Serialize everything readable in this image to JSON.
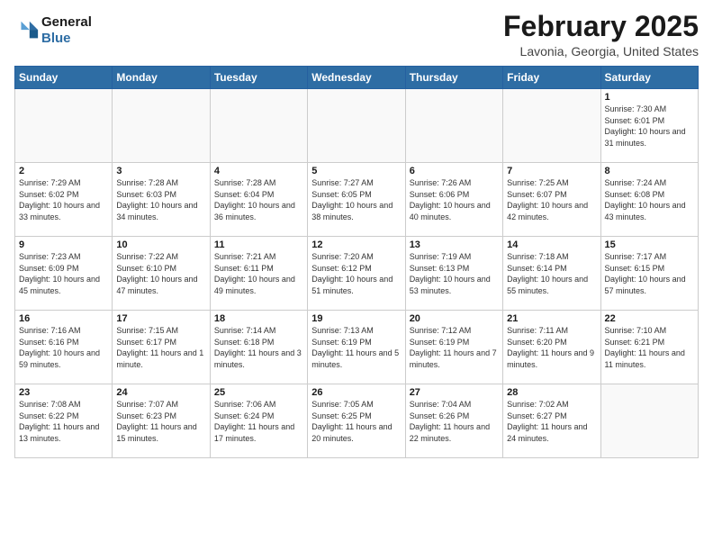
{
  "header": {
    "logo": {
      "line1": "General",
      "line2": "Blue"
    },
    "title": "February 2025",
    "location": "Lavonia, Georgia, United States"
  },
  "weekdays": [
    "Sunday",
    "Monday",
    "Tuesday",
    "Wednesday",
    "Thursday",
    "Friday",
    "Saturday"
  ],
  "weeks": [
    [
      {
        "day": "",
        "info": ""
      },
      {
        "day": "",
        "info": ""
      },
      {
        "day": "",
        "info": ""
      },
      {
        "day": "",
        "info": ""
      },
      {
        "day": "",
        "info": ""
      },
      {
        "day": "",
        "info": ""
      },
      {
        "day": "1",
        "info": "Sunrise: 7:30 AM\nSunset: 6:01 PM\nDaylight: 10 hours and 31 minutes."
      }
    ],
    [
      {
        "day": "2",
        "info": "Sunrise: 7:29 AM\nSunset: 6:02 PM\nDaylight: 10 hours and 33 minutes."
      },
      {
        "day": "3",
        "info": "Sunrise: 7:28 AM\nSunset: 6:03 PM\nDaylight: 10 hours and 34 minutes."
      },
      {
        "day": "4",
        "info": "Sunrise: 7:28 AM\nSunset: 6:04 PM\nDaylight: 10 hours and 36 minutes."
      },
      {
        "day": "5",
        "info": "Sunrise: 7:27 AM\nSunset: 6:05 PM\nDaylight: 10 hours and 38 minutes."
      },
      {
        "day": "6",
        "info": "Sunrise: 7:26 AM\nSunset: 6:06 PM\nDaylight: 10 hours and 40 minutes."
      },
      {
        "day": "7",
        "info": "Sunrise: 7:25 AM\nSunset: 6:07 PM\nDaylight: 10 hours and 42 minutes."
      },
      {
        "day": "8",
        "info": "Sunrise: 7:24 AM\nSunset: 6:08 PM\nDaylight: 10 hours and 43 minutes."
      }
    ],
    [
      {
        "day": "9",
        "info": "Sunrise: 7:23 AM\nSunset: 6:09 PM\nDaylight: 10 hours and 45 minutes."
      },
      {
        "day": "10",
        "info": "Sunrise: 7:22 AM\nSunset: 6:10 PM\nDaylight: 10 hours and 47 minutes."
      },
      {
        "day": "11",
        "info": "Sunrise: 7:21 AM\nSunset: 6:11 PM\nDaylight: 10 hours and 49 minutes."
      },
      {
        "day": "12",
        "info": "Sunrise: 7:20 AM\nSunset: 6:12 PM\nDaylight: 10 hours and 51 minutes."
      },
      {
        "day": "13",
        "info": "Sunrise: 7:19 AM\nSunset: 6:13 PM\nDaylight: 10 hours and 53 minutes."
      },
      {
        "day": "14",
        "info": "Sunrise: 7:18 AM\nSunset: 6:14 PM\nDaylight: 10 hours and 55 minutes."
      },
      {
        "day": "15",
        "info": "Sunrise: 7:17 AM\nSunset: 6:15 PM\nDaylight: 10 hours and 57 minutes."
      }
    ],
    [
      {
        "day": "16",
        "info": "Sunrise: 7:16 AM\nSunset: 6:16 PM\nDaylight: 10 hours and 59 minutes."
      },
      {
        "day": "17",
        "info": "Sunrise: 7:15 AM\nSunset: 6:17 PM\nDaylight: 11 hours and 1 minute."
      },
      {
        "day": "18",
        "info": "Sunrise: 7:14 AM\nSunset: 6:18 PM\nDaylight: 11 hours and 3 minutes."
      },
      {
        "day": "19",
        "info": "Sunrise: 7:13 AM\nSunset: 6:19 PM\nDaylight: 11 hours and 5 minutes."
      },
      {
        "day": "20",
        "info": "Sunrise: 7:12 AM\nSunset: 6:19 PM\nDaylight: 11 hours and 7 minutes."
      },
      {
        "day": "21",
        "info": "Sunrise: 7:11 AM\nSunset: 6:20 PM\nDaylight: 11 hours and 9 minutes."
      },
      {
        "day": "22",
        "info": "Sunrise: 7:10 AM\nSunset: 6:21 PM\nDaylight: 11 hours and 11 minutes."
      }
    ],
    [
      {
        "day": "23",
        "info": "Sunrise: 7:08 AM\nSunset: 6:22 PM\nDaylight: 11 hours and 13 minutes."
      },
      {
        "day": "24",
        "info": "Sunrise: 7:07 AM\nSunset: 6:23 PM\nDaylight: 11 hours and 15 minutes."
      },
      {
        "day": "25",
        "info": "Sunrise: 7:06 AM\nSunset: 6:24 PM\nDaylight: 11 hours and 17 minutes."
      },
      {
        "day": "26",
        "info": "Sunrise: 7:05 AM\nSunset: 6:25 PM\nDaylight: 11 hours and 20 minutes."
      },
      {
        "day": "27",
        "info": "Sunrise: 7:04 AM\nSunset: 6:26 PM\nDaylight: 11 hours and 22 minutes."
      },
      {
        "day": "28",
        "info": "Sunrise: 7:02 AM\nSunset: 6:27 PM\nDaylight: 11 hours and 24 minutes."
      },
      {
        "day": "",
        "info": ""
      }
    ]
  ]
}
